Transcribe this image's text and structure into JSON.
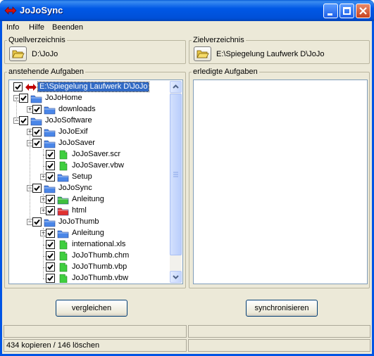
{
  "window": {
    "title": "JoJoSync"
  },
  "menu": {
    "items": [
      {
        "label": "Info"
      },
      {
        "label": "Hilfe"
      },
      {
        "label": "Beenden"
      }
    ]
  },
  "source": {
    "label": "Quellverzeichnis",
    "path": "D:\\JoJo"
  },
  "target": {
    "label": "Zielverzeichnis",
    "path": "E:\\Spiegelung Laufwerk D\\JoJo"
  },
  "pending": {
    "label": "anstehende Aufgaben",
    "rows": [
      {
        "label": "E:\\Spiegelung Laufwerk D\\JoJo",
        "level": 0,
        "type": "root",
        "expander": "",
        "checked": true,
        "selected": true
      },
      {
        "label": "JoJoHome",
        "level": 0,
        "type": "folder-blue",
        "expander": "−",
        "checked": true
      },
      {
        "label": "downloads",
        "level": 1,
        "type": "folder-blue",
        "expander": "+",
        "checked": true
      },
      {
        "label": "JoJoSoftware",
        "level": 0,
        "type": "folder-blue",
        "expander": "−",
        "checked": true
      },
      {
        "label": "JoJoExif",
        "level": 1,
        "type": "folder-blue",
        "expander": "+",
        "checked": true
      },
      {
        "label": "JoJoSaver",
        "level": 1,
        "type": "folder-blue",
        "expander": "−",
        "checked": true
      },
      {
        "label": "JoJoSaver.scr",
        "level": 2,
        "type": "file-green",
        "expander": "",
        "checked": true
      },
      {
        "label": "JoJoSaver.vbw",
        "level": 2,
        "type": "file-green",
        "expander": "",
        "checked": true
      },
      {
        "label": "Setup",
        "level": 2,
        "type": "folder-blue",
        "expander": "+",
        "checked": true
      },
      {
        "label": "JoJoSync",
        "level": 1,
        "type": "folder-blue",
        "expander": "−",
        "checked": true
      },
      {
        "label": "Anleitung",
        "level": 2,
        "type": "folder-green",
        "expander": "+",
        "checked": true
      },
      {
        "label": "html",
        "level": 2,
        "type": "folder-red",
        "expander": "+",
        "checked": true
      },
      {
        "label": "JoJoThumb",
        "level": 1,
        "type": "folder-blue",
        "expander": "−",
        "checked": true
      },
      {
        "label": "Anleitung",
        "level": 2,
        "type": "folder-blue",
        "expander": "+",
        "checked": true
      },
      {
        "label": "international.xls",
        "level": 2,
        "type": "file-green",
        "expander": "",
        "checked": true
      },
      {
        "label": "JoJoThumb.chm",
        "level": 2,
        "type": "file-green",
        "expander": "",
        "checked": true
      },
      {
        "label": "JoJoThumb.vbp",
        "level": 2,
        "type": "file-green",
        "expander": "",
        "checked": true
      },
      {
        "label": "JoJoThumb.vbw",
        "level": 2,
        "type": "file-green",
        "expander": "",
        "checked": true
      }
    ]
  },
  "done": {
    "label": "erledigte Aufgaben"
  },
  "buttons": {
    "compare": "vergleichen",
    "sync": "synchronisieren"
  },
  "status": {
    "left_top": "",
    "right_top": "",
    "left_bottom": "434 kopieren / 146 löschen",
    "right_bottom": ""
  },
  "colors": {
    "selection": "#316ac5",
    "folder_blue": "#4a86e8",
    "folder_green": "#3fbf3f",
    "folder_red": "#e03030",
    "file_green": "#3fcf3f",
    "sync_arrow": "#c00000"
  }
}
